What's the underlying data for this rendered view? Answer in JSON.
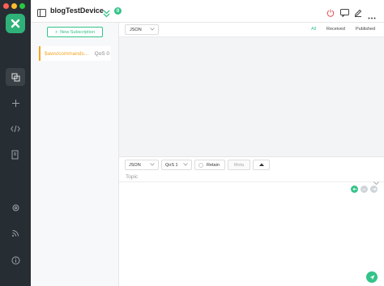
{
  "header": {
    "device_name": "blogTestDevice",
    "connection_count": "0"
  },
  "subscriptions": {
    "new_button_label": "New Subscription",
    "items": [
      {
        "topic": "$aws/commands...",
        "qos": "QoS 0",
        "color": "#f5a623"
      }
    ]
  },
  "messages": {
    "format": "JSON",
    "tabs": [
      "All",
      "Received",
      "Published"
    ],
    "active_tab": "All"
  },
  "publish": {
    "payload_format": "JSON",
    "qos": "QoS 1",
    "retain_label": "Retain",
    "meta_label": "Meta",
    "topic_placeholder": "Topic"
  },
  "colors": {
    "accent": "#34c388",
    "sidebar_bg": "#272e33",
    "subscription_accent": "#f5a623"
  },
  "icons": [
    "logo-icon",
    "connections-icon",
    "new-connection-icon",
    "script-icon",
    "log-icon",
    "settings-icon",
    "feed-icon",
    "about-icon",
    "sidebar-toggle-icon",
    "double-chevron-icon",
    "power-icon",
    "chat-icon",
    "edit-icon",
    "more-icon",
    "send-icon"
  ]
}
